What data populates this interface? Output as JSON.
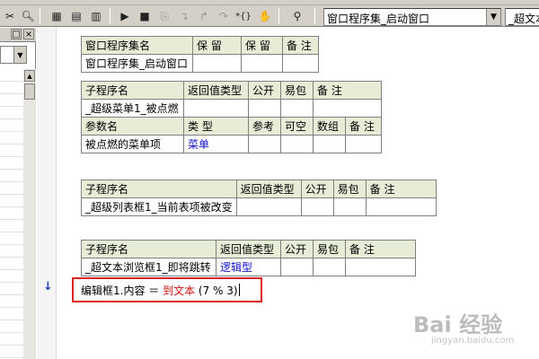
{
  "toolbar": {
    "object_combo": {
      "value": "窗口程序集_启动窗口"
    },
    "sub_combo": {
      "value": "_超文本"
    },
    "icons": [
      "window-icon",
      "form-icon",
      "list-icon",
      "run-icon",
      "stop-icon",
      "step-icon",
      "step-into-icon",
      "step-out-icon",
      "run-to-cursor-icon",
      "toggle-breakpoint-icon",
      "hand-icon",
      "find-icon"
    ]
  },
  "left_panel": {
    "close_label": "×"
  },
  "assembly_table": {
    "headers": [
      "窗口程序集名",
      "保 留",
      "保 留",
      "备 注"
    ],
    "row": [
      "窗口程序集_启动窗口",
      "",
      "",
      ""
    ]
  },
  "sub1": {
    "headers": [
      "子程序名",
      "返回值类型",
      "公开",
      "易包",
      "备 注"
    ],
    "row": [
      "_超级菜单1_被点燃",
      "",
      "",
      "",
      ""
    ],
    "param_headers": [
      "参数名",
      "类 型",
      "参考",
      "可空",
      "数组",
      "备 注"
    ],
    "param_row": [
      "被点燃的菜单项",
      "菜单",
      "",
      "",
      "",
      ""
    ]
  },
  "sub2": {
    "headers": [
      "子程序名",
      "返回值类型",
      "公开",
      "易包",
      "备 注"
    ],
    "row": [
      "_超级列表框1_当前表项被改变",
      "",
      "",
      "",
      ""
    ]
  },
  "sub3": {
    "headers": [
      "子程序名",
      "返回值类型",
      "公开",
      "易包",
      "备 注"
    ],
    "row": [
      "_超文本浏览框1_即将跳转",
      "逻辑型",
      "",
      "",
      ""
    ]
  },
  "code": {
    "lhs": "编辑框1.内容 ＝ ",
    "func": "到文本",
    "args": " (7 % 3)"
  },
  "gutter": {
    "marker": "↓"
  },
  "watermark": {
    "logo": "Bai 经验",
    "sub": "jingyan.baidu.com"
  }
}
